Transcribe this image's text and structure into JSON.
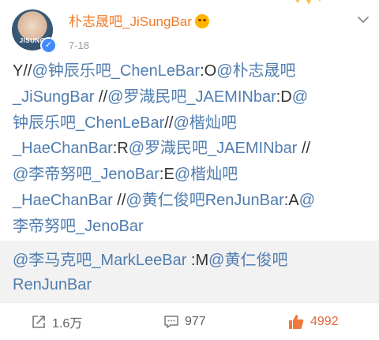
{
  "header": {
    "avatar_text": "JISUNG",
    "username": "朴志晟吧_JiSungBar",
    "timestamp": "7-18"
  },
  "post": {
    "lines": [
      [
        {
          "text": "Y//",
          "mention": false
        },
        {
          "text": "@钟辰乐吧_ChenLeBar",
          "mention": true
        },
        {
          "text": ":O",
          "mention": false
        },
        {
          "text": "@朴志晟吧",
          "mention": true
        }
      ],
      [
        {
          "text": "_JiSungBar",
          "mention": true
        },
        {
          "text": " //",
          "mention": false
        },
        {
          "text": "@罗渽民吧_JAEMINbar",
          "mention": true
        },
        {
          "text": ":D",
          "mention": false
        },
        {
          "text": "@",
          "mention": true
        }
      ],
      [
        {
          "text": "钟辰乐吧_ChenLeBar",
          "mention": true
        },
        {
          "text": "//",
          "mention": false
        },
        {
          "text": "@楷灿吧",
          "mention": true
        }
      ],
      [
        {
          "text": "_HaeChanBar",
          "mention": true
        },
        {
          "text": ":R",
          "mention": false
        },
        {
          "text": "@罗渽民吧_JAEMINbar",
          "mention": true
        },
        {
          "text": " //",
          "mention": false
        }
      ],
      [
        {
          "text": "@李帝努吧_JenoBar",
          "mention": true
        },
        {
          "text": ":E",
          "mention": false
        },
        {
          "text": "@楷灿吧",
          "mention": true
        }
      ],
      [
        {
          "text": "_HaeChanBar",
          "mention": true
        },
        {
          "text": " //",
          "mention": false
        },
        {
          "text": "@黄仁俊吧RenJunBar",
          "mention": true
        },
        {
          "text": ":A",
          "mention": false
        },
        {
          "text": "@",
          "mention": true
        }
      ],
      [
        {
          "text": "李帝努吧_JenoBar",
          "mention": true
        }
      ]
    ]
  },
  "quote": {
    "lines": [
      [
        {
          "text": "@李马克吧_MarkLeeBar",
          "mention": true
        },
        {
          "text": " :M",
          "mention": false
        },
        {
          "text": "@黄仁俊吧",
          "mention": true
        }
      ],
      [
        {
          "text": "RenJunBar",
          "mention": true
        }
      ]
    ]
  },
  "footer": {
    "share_count": "1.6万",
    "comment_count": "977",
    "like_count": "4992"
  },
  "colors": {
    "username": "#f07a26",
    "mention": "#507daf",
    "text": "#333333",
    "like": "#e8643c",
    "quote_bg": "#f2f2f2",
    "verified": "#3f8bff"
  },
  "icons": {
    "more": "chevron-down-icon",
    "share": "share-icon",
    "comment": "comment-icon",
    "like": "thumbs-up-icon",
    "verified": "verified-badge-icon",
    "vip": "emoji-badge-icon",
    "crown": "crown-icon"
  }
}
